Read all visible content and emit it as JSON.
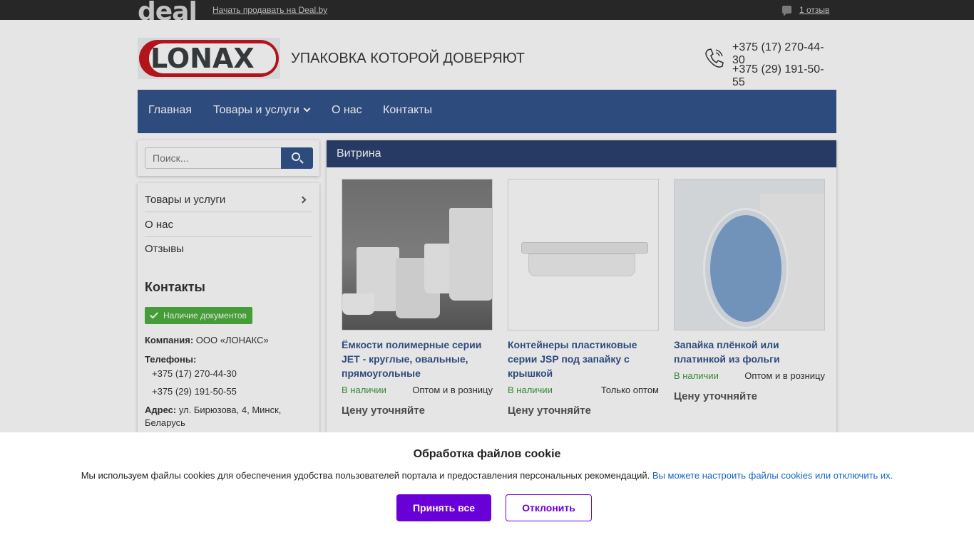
{
  "topbar": {
    "logo": "deal",
    "sell_link": "Начать продавать на Deal.by",
    "reviews": "1 отзыв"
  },
  "header": {
    "brand": "LONAX",
    "tagline": "УПАКОВКА КОТОРОЙ ДОВЕРЯЮТ",
    "phone1": "+375 (17) 270-44-30",
    "phone2": "+375 (29) 191-50-55"
  },
  "nav": {
    "items": [
      {
        "label": "Главная"
      },
      {
        "label": "Товары и услуги"
      },
      {
        "label": "О нас"
      },
      {
        "label": "Контакты"
      }
    ]
  },
  "search": {
    "placeholder": "Поиск..."
  },
  "sidebar": {
    "menu": [
      {
        "label": "Товары и услуги"
      },
      {
        "label": "О нас"
      },
      {
        "label": "Отзывы"
      }
    ],
    "contacts_title": "Контакты",
    "doc_badge": "Наличие документов",
    "company_label": "Компания:",
    "company_value": "ООО «ЛОНАКС»",
    "phones_label": "Телефоны:",
    "phone1": "+375 (17) 270-44-30",
    "phone2": "+375 (29) 191-50-55",
    "address_label": "Адрес:",
    "address_value": "ул. Бирюзова, 4, Минск, Беларусь"
  },
  "main": {
    "heading": "Витрина",
    "products": [
      {
        "title": "Ёмкости полимерные серии JET - круглые, овальные, прямоугольные",
        "stock": "В наличии",
        "sale": "Оптом и в розницу",
        "price": "Цену уточняйте"
      },
      {
        "title": "Контейнеры пластиковые серии JSP под запайку с крышкой",
        "stock": "В наличии",
        "sale": "Только оптом",
        "price": "Цену уточняйте"
      },
      {
        "title": "Запайка плёнкой или платинкой из фольги",
        "stock": "В наличии",
        "sale": "Оптом и в розницу",
        "price": "Цену уточняйте"
      }
    ]
  },
  "cookie": {
    "title": "Обработка файлов cookie",
    "text": "Мы используем файлы cookies для обеспечения удобства пользователей портала и предоставления персональных рекомендаций.",
    "link": "Вы можете настроить файлы cookies или отключить их.",
    "accept": "Принять все",
    "decline": "Отклонить"
  },
  "colors": {
    "nav_bg": "#34548c",
    "accent_purple": "#6a00d8",
    "in_stock": "#3a9a3a"
  }
}
